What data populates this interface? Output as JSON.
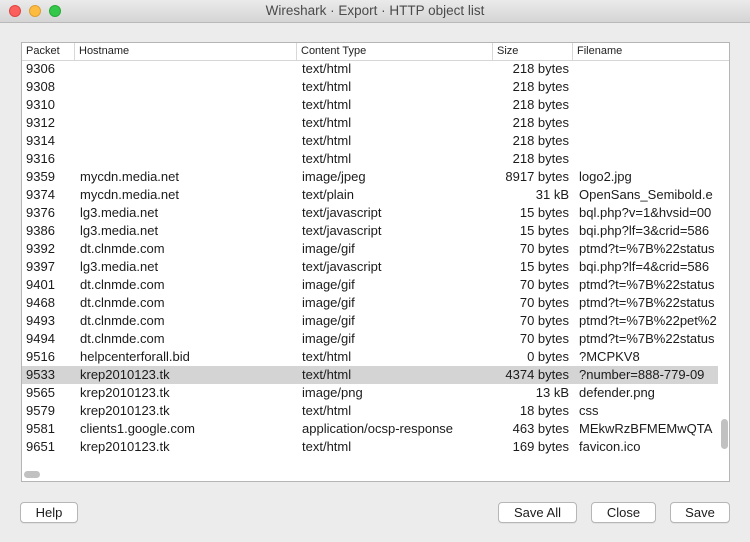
{
  "window": {
    "title": "Wireshark · Export · HTTP object list"
  },
  "table": {
    "columns": [
      "Packet",
      "Hostname",
      "Content Type",
      "Size",
      "Filename"
    ],
    "rows": [
      [
        "9306",
        "",
        "text/html",
        "218 bytes",
        ""
      ],
      [
        "9308",
        "",
        "text/html",
        "218 bytes",
        ""
      ],
      [
        "9310",
        "",
        "text/html",
        "218 bytes",
        ""
      ],
      [
        "9312",
        "",
        "text/html",
        "218 bytes",
        ""
      ],
      [
        "9314",
        "",
        "text/html",
        "218 bytes",
        ""
      ],
      [
        "9316",
        "",
        "text/html",
        "218 bytes",
        ""
      ],
      [
        "9359",
        "mycdn.media.net",
        "image/jpeg",
        "8917 bytes",
        "logo2.jpg"
      ],
      [
        "9374",
        "mycdn.media.net",
        "text/plain",
        "31 kB",
        "OpenSans_Semibold.e"
      ],
      [
        "9376",
        "lg3.media.net",
        "text/javascript",
        "15 bytes",
        "bql.php?v=1&hvsid=00"
      ],
      [
        "9386",
        "lg3.media.net",
        "text/javascript",
        "15 bytes",
        "bqi.php?lf=3&crid=586"
      ],
      [
        "9392",
        "dt.clnmde.com",
        "image/gif",
        "70 bytes",
        "ptmd?t=%7B%22status"
      ],
      [
        "9397",
        "lg3.media.net",
        "text/javascript",
        "15 bytes",
        "bqi.php?lf=4&crid=586"
      ],
      [
        "9401",
        "dt.clnmde.com",
        "image/gif",
        "70 bytes",
        "ptmd?t=%7B%22status"
      ],
      [
        "9468",
        "dt.clnmde.com",
        "image/gif",
        "70 bytes",
        "ptmd?t=%7B%22status"
      ],
      [
        "9493",
        "dt.clnmde.com",
        "image/gif",
        "70 bytes",
        "ptmd?t=%7B%22pet%2"
      ],
      [
        "9494",
        "dt.clnmde.com",
        "image/gif",
        "70 bytes",
        "ptmd?t=%7B%22status"
      ],
      [
        "9516",
        "helpcenterforall.bid",
        "text/html",
        "0 bytes",
        "?MCPKV8"
      ],
      [
        "9533",
        "krep2010123.tk",
        "text/html",
        "4374 bytes",
        "?number=888-779-09"
      ],
      [
        "9565",
        "krep2010123.tk",
        "image/png",
        "13 kB",
        "defender.png"
      ],
      [
        "9579",
        "krep2010123.tk",
        "text/html",
        "18 bytes",
        "css"
      ],
      [
        "9581",
        "clients1.google.com",
        "application/ocsp-response",
        "463 bytes",
        "MEkwRzBFMEMwQTA"
      ],
      [
        "9651",
        "krep2010123.tk",
        "text/html",
        "169 bytes",
        "favicon.ico"
      ]
    ],
    "selected_row": 17
  },
  "buttons": {
    "help": "Help",
    "save_all": "Save All",
    "close": "Close",
    "save": "Save"
  }
}
